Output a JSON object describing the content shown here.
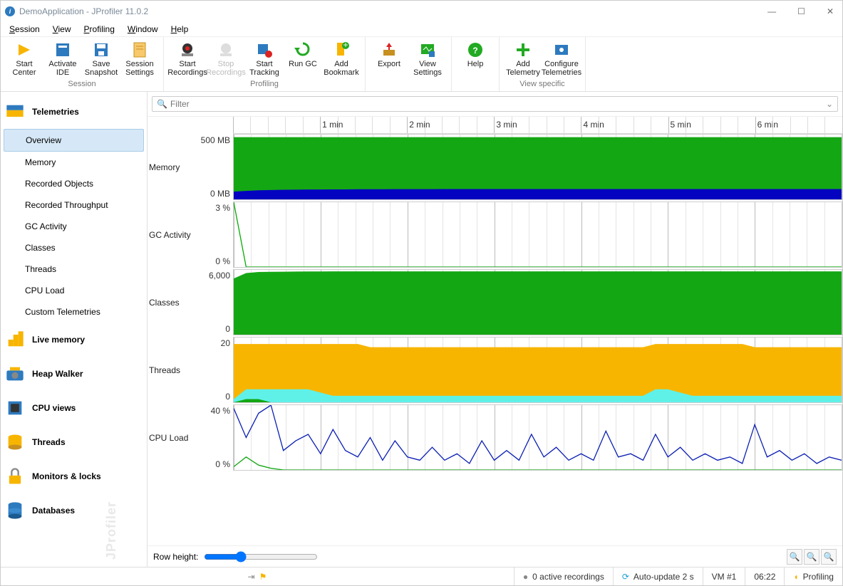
{
  "title": "DemoApplication - JProfiler 11.0.2",
  "menu": [
    "Session",
    "View",
    "Profiling",
    "Window",
    "Help"
  ],
  "toolbar_groups": [
    {
      "label": "Session",
      "buttons": [
        {
          "id": "start-center",
          "l1": "Start",
          "l2": "Center"
        },
        {
          "id": "activate-ide",
          "l1": "Activate",
          "l2": "IDE"
        },
        {
          "id": "save-snapshot",
          "l1": "Save",
          "l2": "Snapshot"
        },
        {
          "id": "session-settings",
          "l1": "Session",
          "l2": "Settings"
        }
      ]
    },
    {
      "label": "Profiling",
      "buttons": [
        {
          "id": "start-recordings",
          "l1": "Start",
          "l2": "Recordings"
        },
        {
          "id": "stop-recordings",
          "l1": "Stop",
          "l2": "Recordings",
          "disabled": true
        },
        {
          "id": "start-tracking",
          "l1": "Start",
          "l2": "Tracking"
        },
        {
          "id": "run-gc",
          "l1": "Run GC",
          "l2": ""
        },
        {
          "id": "add-bookmark",
          "l1": "Add",
          "l2": "Bookmark"
        }
      ]
    },
    {
      "label": "",
      "buttons": [
        {
          "id": "export",
          "l1": "Export",
          "l2": ""
        },
        {
          "id": "view-settings",
          "l1": "View",
          "l2": "Settings"
        }
      ]
    },
    {
      "label": "",
      "buttons": [
        {
          "id": "help",
          "l1": "Help",
          "l2": ""
        }
      ]
    },
    {
      "label": "View specific",
      "buttons": [
        {
          "id": "add-telemetry",
          "l1": "Add",
          "l2": "Telemetry"
        },
        {
          "id": "configure-telemetries",
          "l1": "Configure",
          "l2": "Telemetries"
        }
      ]
    }
  ],
  "sidebar": {
    "header": "Telemetries",
    "items": [
      "Overview",
      "Memory",
      "Recorded Objects",
      "Recorded Throughput",
      "GC Activity",
      "Classes",
      "Threads",
      "CPU Load",
      "Custom Telemetries"
    ],
    "sections": [
      "Live memory",
      "Heap Walker",
      "CPU views",
      "Threads",
      "Monitors & locks",
      "Databases"
    ]
  },
  "filter_placeholder": "Filter",
  "time_labels": [
    "1 min",
    "2 min",
    "3 min",
    "4 min",
    "5 min",
    "6 min"
  ],
  "row_height_label": "Row height:",
  "status": {
    "recordings": "0 active recordings",
    "update": "Auto-update 2 s",
    "vm": "VM #1",
    "clock": "06:22",
    "state": "Profiling"
  },
  "chart_data": [
    {
      "name": "Memory",
      "type": "area",
      "ylim": [
        0,
        500
      ],
      "yunit": "MB",
      "y_top": "500 MB",
      "y_bot": "0 MB",
      "series": [
        {
          "name": "heap-max",
          "color": "#14a714",
          "values": [
            480,
            480,
            480,
            480,
            480,
            480,
            480,
            480,
            480,
            480,
            480,
            480,
            480,
            480,
            480,
            480,
            480,
            480,
            480,
            480,
            480,
            480,
            480,
            480,
            480,
            480,
            480,
            480,
            480,
            480,
            480,
            480,
            480,
            480,
            480,
            480,
            480,
            480,
            480,
            480,
            480,
            480,
            480,
            480,
            480,
            480,
            480,
            480,
            480,
            480
          ]
        },
        {
          "name": "heap-used",
          "color": "#0404c0",
          "values": [
            60,
            65,
            70,
            72,
            74,
            75,
            76,
            76,
            77,
            77,
            78,
            78,
            78,
            79,
            79,
            79,
            79,
            80,
            80,
            80,
            80,
            80,
            80,
            80,
            80,
            80,
            80,
            80,
            80,
            80,
            80,
            80,
            80,
            80,
            80,
            80,
            80,
            80,
            80,
            80,
            80,
            80,
            80,
            80,
            80,
            80,
            80,
            80,
            80,
            80
          ]
        }
      ]
    },
    {
      "name": "GC Activity",
      "type": "line",
      "ylim": [
        0,
        3
      ],
      "yunit": "%",
      "y_top": "3 %",
      "y_bot": "0 %",
      "series": [
        {
          "name": "gc",
          "color": "#0a0",
          "values": [
            3,
            0,
            0,
            0,
            0,
            0,
            0,
            0,
            0,
            0,
            0,
            0,
            0,
            0,
            0,
            0,
            0,
            0,
            0,
            0,
            0,
            0,
            0,
            0,
            0,
            0,
            0,
            0,
            0,
            0,
            0,
            0,
            0,
            0,
            0,
            0,
            0,
            0,
            0,
            0,
            0,
            0,
            0,
            0,
            0,
            0,
            0,
            0,
            0,
            0
          ]
        }
      ]
    },
    {
      "name": "Classes",
      "type": "area",
      "ylim": [
        0,
        6000
      ],
      "yunit": "",
      "y_top": "6,000",
      "y_bot": "0",
      "series": [
        {
          "name": "classes",
          "color": "#14a714",
          "values": [
            5200,
            5700,
            5800,
            5820,
            5830,
            5840,
            5850,
            5855,
            5860,
            5860,
            5860,
            5860,
            5860,
            5860,
            5860,
            5860,
            5860,
            5860,
            5860,
            5860,
            5860,
            5860,
            5860,
            5860,
            5860,
            5860,
            5860,
            5860,
            5860,
            5860,
            5860,
            5860,
            5860,
            5860,
            5860,
            5860,
            5860,
            5860,
            5860,
            5860,
            5860,
            5860,
            5860,
            5860,
            5860,
            5860,
            5860,
            5860,
            5860,
            5860
          ]
        }
      ]
    },
    {
      "name": "Threads",
      "type": "area",
      "ylim": [
        0,
        20
      ],
      "yunit": "",
      "y_top": "20",
      "y_bot": "0",
      "series": [
        {
          "name": "total",
          "color": "#f7b500",
          "values": [
            18,
            18,
            18,
            18,
            18,
            18,
            18,
            18,
            18,
            18,
            18,
            17,
            17,
            17,
            17,
            17,
            17,
            17,
            17,
            17,
            17,
            17,
            17,
            17,
            17,
            17,
            17,
            17,
            17,
            17,
            17,
            17,
            17,
            17,
            18,
            18,
            18,
            18,
            18,
            18,
            18,
            18,
            17,
            17,
            17,
            17,
            17,
            17,
            17,
            17
          ]
        },
        {
          "name": "runnable",
          "color": "#5ff1e8",
          "values": [
            1,
            4,
            4,
            4,
            4,
            4,
            4,
            3,
            2,
            2,
            2,
            2,
            2,
            2,
            2,
            2,
            2,
            2,
            2,
            2,
            2,
            2,
            2,
            2,
            2,
            2,
            2,
            2,
            2,
            2,
            2,
            2,
            2,
            2,
            4,
            4,
            3,
            2,
            2,
            2,
            2,
            2,
            2,
            2,
            2,
            2,
            2,
            2,
            2,
            2
          ]
        },
        {
          "name": "blocked",
          "color": "#14a714",
          "values": [
            0,
            1,
            1,
            0,
            0,
            0,
            0,
            0,
            0,
            0,
            0,
            0,
            0,
            0,
            0,
            0,
            0,
            0,
            0,
            0,
            0,
            0,
            0,
            0,
            0,
            0,
            0,
            0,
            0,
            0,
            0,
            0,
            0,
            0,
            0,
            0,
            0,
            0,
            0,
            0,
            0,
            0,
            0,
            0,
            0,
            0,
            0,
            0,
            0,
            0
          ]
        }
      ]
    },
    {
      "name": "CPU Load",
      "type": "line",
      "ylim": [
        0,
        40
      ],
      "yunit": "%",
      "y_top": "40 %",
      "y_bot": "0 %",
      "series": [
        {
          "name": "gc-cpu",
          "color": "#14a714",
          "values": [
            2,
            8,
            3,
            1,
            0,
            0,
            0,
            0,
            0,
            0,
            0,
            0,
            0,
            0,
            0,
            0,
            0,
            0,
            0,
            0,
            0,
            0,
            0,
            0,
            0,
            0,
            0,
            0,
            0,
            0,
            0,
            0,
            0,
            0,
            0,
            0,
            0,
            0,
            0,
            0,
            0,
            0,
            0,
            0,
            0,
            0,
            0,
            0,
            0,
            0
          ]
        },
        {
          "name": "process",
          "color": "#0b1fb3",
          "values": [
            38,
            20,
            35,
            40,
            12,
            18,
            22,
            10,
            25,
            12,
            8,
            20,
            6,
            18,
            8,
            6,
            14,
            6,
            10,
            4,
            18,
            6,
            12,
            6,
            22,
            8,
            14,
            6,
            10,
            6,
            24,
            8,
            10,
            6,
            22,
            8,
            14,
            6,
            10,
            6,
            8,
            4,
            28,
            8,
            12,
            6,
            10,
            4,
            8,
            6
          ]
        }
      ]
    }
  ]
}
